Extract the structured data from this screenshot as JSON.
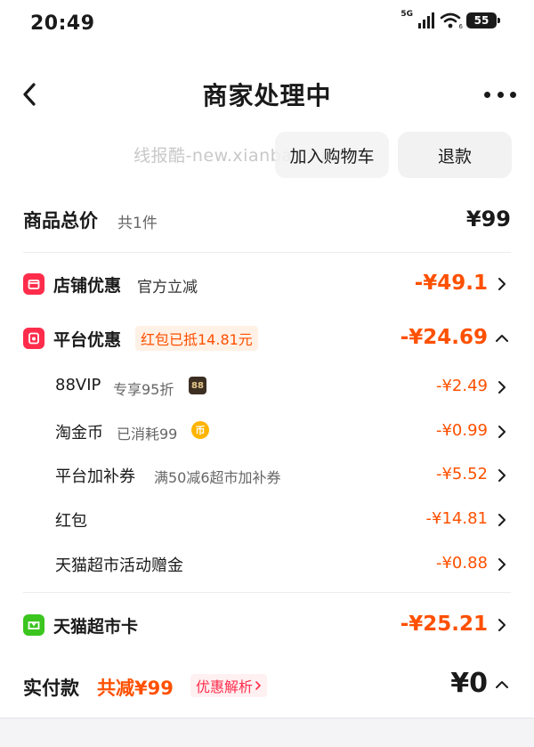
{
  "status_bar": {
    "time": "20:49",
    "network": "5G",
    "wifi_sub": "6",
    "battery": "55"
  },
  "header": {
    "title": "商家处理中"
  },
  "watermark": "线报酷-new.xianbao.fun",
  "actions": {
    "add_to_cart": "加入购物车",
    "refund": "退款"
  },
  "total": {
    "label": "商品总价",
    "count": "共1件",
    "value": "¥99"
  },
  "store_discount": {
    "label": "店铺优惠",
    "sub": "官方立减",
    "amount": "-¥49.1"
  },
  "platform_discount": {
    "label": "平台优惠",
    "tag": "红包已抵14.81元",
    "amount": "-¥24.69",
    "items": [
      {
        "label": "88VIP",
        "note": "专享95折",
        "badge": "88",
        "amount": "-¥2.49"
      },
      {
        "label": "淘金币",
        "note": "已消耗99",
        "badge": "币",
        "amount": "-¥0.99"
      },
      {
        "label": "平台加补券",
        "note": "满50减6超市加补券",
        "amount": "-¥5.52"
      },
      {
        "label": "红包",
        "note": "",
        "amount": "-¥14.81"
      },
      {
        "label": "天猫超市活动赠金",
        "note": "",
        "amount": "-¥0.88"
      }
    ]
  },
  "tmall_card": {
    "label": "天猫超市卡",
    "amount": "-¥25.21"
  },
  "payment": {
    "label": "实付款",
    "reduce": "共减¥99",
    "analysis": "优惠解析",
    "value": "¥0"
  },
  "colors": {
    "accent": "#ff5000",
    "store_icon": "#ff2d4b",
    "card_icon": "#3cc51f"
  }
}
